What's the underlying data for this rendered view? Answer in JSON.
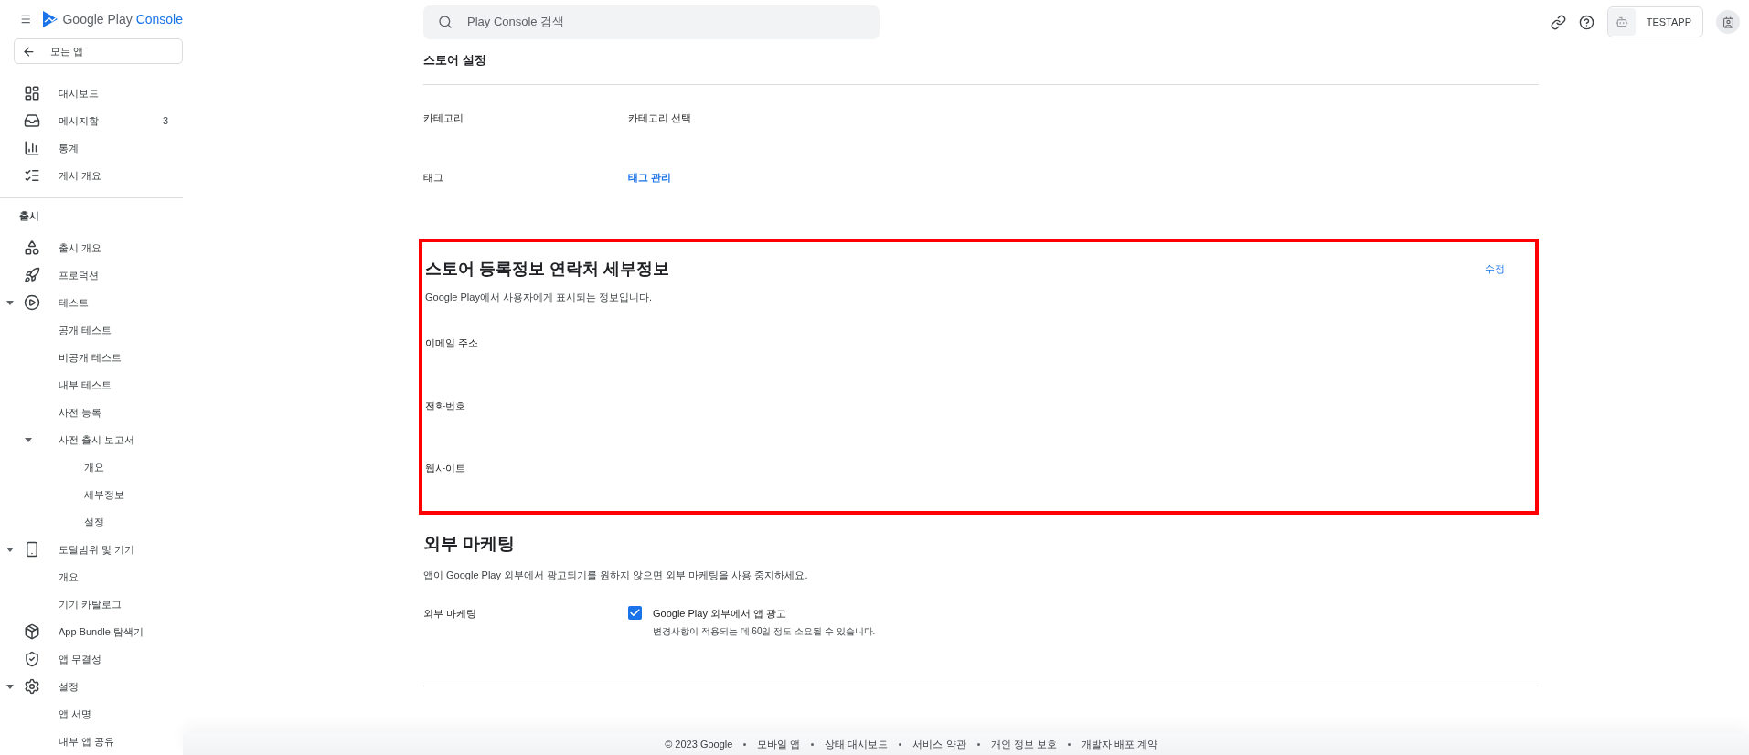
{
  "app_bar": {
    "brand_main": "Google Play",
    "brand_accent": "Console",
    "search": {
      "placeholder": "Play Console 검색"
    },
    "app_chip": "TESTAPP"
  },
  "sidebar": {
    "back_button": "모든 앱",
    "top_items": [
      {
        "label": "대시보드"
      },
      {
        "label": "메시지함",
        "badge": "3"
      },
      {
        "label": "통계"
      },
      {
        "label": "게시 개요"
      }
    ],
    "section_title": "출시",
    "items": [
      {
        "label": "출시 개요"
      },
      {
        "label": "프로덕션"
      },
      {
        "label": "테스트",
        "expanded": true,
        "children": [
          {
            "label": "공개 테스트"
          },
          {
            "label": "비공개 테스트"
          },
          {
            "label": "내부 테스트"
          },
          {
            "label": "사전 등록"
          },
          {
            "label": "사전 출시 보고서",
            "expanded": true,
            "children": [
              {
                "label": "개요"
              },
              {
                "label": "세부정보"
              },
              {
                "label": "설정"
              }
            ]
          }
        ]
      },
      {
        "label": "도달범위 및 기기",
        "expanded": true,
        "children": [
          {
            "label": "개요"
          },
          {
            "label": "기기 카탈로그"
          }
        ]
      },
      {
        "label": "App Bundle 탐색기"
      },
      {
        "label": "앱 무결성"
      },
      {
        "label": "설정",
        "expanded": true,
        "children": [
          {
            "label": "앱 서명"
          },
          {
            "label": "내부 앱 공유"
          }
        ]
      }
    ]
  },
  "store_settings": {
    "title": "스토어 설정",
    "rows": [
      {
        "label": "카테고리",
        "value": "카테고리 선택",
        "kind": "text"
      },
      {
        "label": "태그",
        "value": "태그 관리",
        "kind": "link"
      }
    ]
  },
  "contact_details": {
    "title": "스토어 등록정보 연락처 세부정보",
    "edit": "수정",
    "description": "Google Play에서 사용자에게 표시되는 정보입니다.",
    "fields": [
      "이메일 주소",
      "전화번호",
      "웹사이트"
    ]
  },
  "external_marketing": {
    "title": "외부 마케팅",
    "description": "앱이 Google Play 외부에서 광고되기를 원하지 않으면 외부 마케팅을 사용 중지하세요.",
    "label": "외부 마케팅",
    "option": {
      "label": "Google Play 외부에서 앱 광고",
      "note": "변경사항이 적용되는 데 60일 정도 소요될 수 있습니다.",
      "checked": true
    }
  },
  "footer": [
    "© 2023 Google",
    "모바일 앱",
    "상태 대시보드",
    "서비스 약관",
    "개인 정보 보호",
    "개발자 배포 계약"
  ]
}
